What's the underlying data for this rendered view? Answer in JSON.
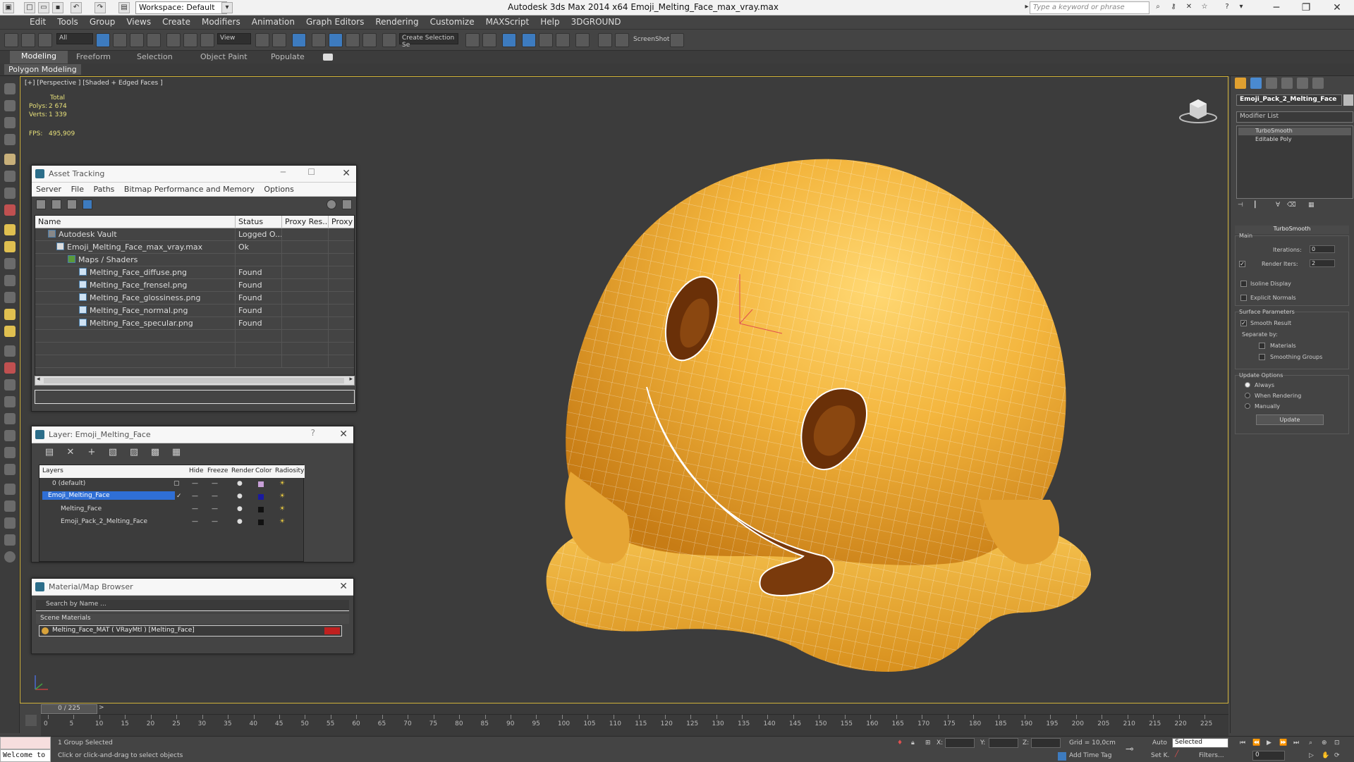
{
  "titlebar": {
    "workspace": "Workspace: Default",
    "app_title": "Autodesk 3ds Max  2014 x64     Emoji_Melting_Face_max_vray.max",
    "search_placeholder": "Type a keyword or phrase"
  },
  "menu": [
    "Edit",
    "Tools",
    "Group",
    "Views",
    "Create",
    "Modifiers",
    "Animation",
    "Graph Editors",
    "Rendering",
    "Customize",
    "MAXScript",
    "Help",
    "3DGROUND"
  ],
  "toolbar": {
    "filter_select": "All",
    "ref_coord": "View",
    "selection_set": "Create Selection Se",
    "screenshot_label": "ScreenShot"
  },
  "ribbon": {
    "tabs": [
      "Modeling",
      "Freeform",
      "Selection",
      "Object Paint",
      "Populate"
    ],
    "subtab": "Polygon Modeling"
  },
  "viewport": {
    "label": "[+] [Perspective ] [Shaded + Edged Faces ]",
    "stats_header": "Total",
    "polys_label": "Polys:",
    "polys_value": "2 674",
    "verts_label": "Verts:",
    "verts_value": "1 339",
    "fps_label": "FPS:",
    "fps_value": "495,909"
  },
  "asset_tracking": {
    "title": "Asset Tracking",
    "menu": [
      "Server",
      "File",
      "Paths",
      "Bitmap Performance and Memory",
      "Options"
    ],
    "columns": [
      "Name",
      "Status",
      "Proxy Res...",
      "Proxy S"
    ],
    "rows": [
      {
        "name": "Autodesk Vault",
        "status": "Logged O...",
        "indent": 0
      },
      {
        "name": "Emoji_Melting_Face_max_vray.max",
        "status": "Ok",
        "indent": 1
      },
      {
        "name": "Maps / Shaders",
        "status": "",
        "indent": 2
      },
      {
        "name": "Melting_Face_diffuse.png",
        "status": "Found",
        "indent": 3
      },
      {
        "name": "Melting_Face_frensel.png",
        "status": "Found",
        "indent": 3
      },
      {
        "name": "Melting_Face_glossiness.png",
        "status": "Found",
        "indent": 3
      },
      {
        "name": "Melting_Face_normal.png",
        "status": "Found",
        "indent": 3
      },
      {
        "name": "Melting_Face_specular.png",
        "status": "Found",
        "indent": 3
      }
    ]
  },
  "layer_panel": {
    "title": "Layer: Emoji_Melting_Face",
    "columns": [
      "Layers",
      "Hide",
      "Freeze",
      "Render",
      "Color",
      "Radiosity"
    ],
    "rows": [
      {
        "name": "0 (default)",
        "color": "#c8a0d8"
      },
      {
        "name": "Emoji_Melting_Face",
        "color": "#1a1aa0"
      },
      {
        "name": "Melting_Face",
        "color": "#111111"
      },
      {
        "name": "Emoji_Pack_2_Melting_Face",
        "color": "#111111"
      }
    ]
  },
  "material_browser": {
    "title": "Material/Map Browser",
    "search_placeholder": "Search by Name ...",
    "section": "Scene Materials",
    "item": "Melting_Face_MAT  ( VRayMtl )  [Melting_Face]"
  },
  "command_panel": {
    "object_name": "Emoji_Pack_2_Melting_Face",
    "modifier_list": "Modifier List",
    "stack": [
      "TurboSmooth",
      "Editable Poly"
    ],
    "rollout_title": "TurboSmooth",
    "main_label": "Main",
    "iterations_label": "Iterations:",
    "iterations_value": "0",
    "render_iters_label": "Render Iters:",
    "render_iters_value": "2",
    "isoline_label": "Isoline Display",
    "explicit_label": "Explicit Normals",
    "surface_params_label": "Surface Parameters",
    "smooth_result_label": "Smooth Result",
    "separate_by_label": "Separate by:",
    "materials_label": "Materials",
    "smoothing_groups_label": "Smoothing Groups",
    "update_options_label": "Update Options",
    "always_label": "Always",
    "when_rendering_label": "When Rendering",
    "manually_label": "Manually",
    "update_button": "Update"
  },
  "timeline": {
    "frame_indicator": "0 / 225",
    "ticks": [
      0,
      5,
      10,
      15,
      20,
      25,
      30,
      35,
      40,
      45,
      50,
      55,
      60,
      65,
      70,
      75,
      80,
      85,
      90,
      95,
      100,
      105,
      110,
      115,
      120,
      125,
      130,
      135,
      140,
      145,
      150,
      155,
      160,
      165,
      170,
      175,
      180,
      185,
      190,
      195,
      200,
      205,
      210,
      215,
      220,
      225
    ],
    "max_frame": 225
  },
  "statusbar": {
    "welcome": "Welcome to",
    "selection": "1 Group Selected",
    "prompt": "Click or click-and-drag to select objects",
    "x_label": "X:",
    "y_label": "Y:",
    "z_label": "Z:",
    "grid": "Grid = 10,0cm",
    "add_time_tag": "Add Time Tag",
    "auto_label": "Auto",
    "selected_dropdown": "Selected",
    "setk_label": "Set K.",
    "filters_label": "Filters...",
    "frame_value": "0"
  }
}
